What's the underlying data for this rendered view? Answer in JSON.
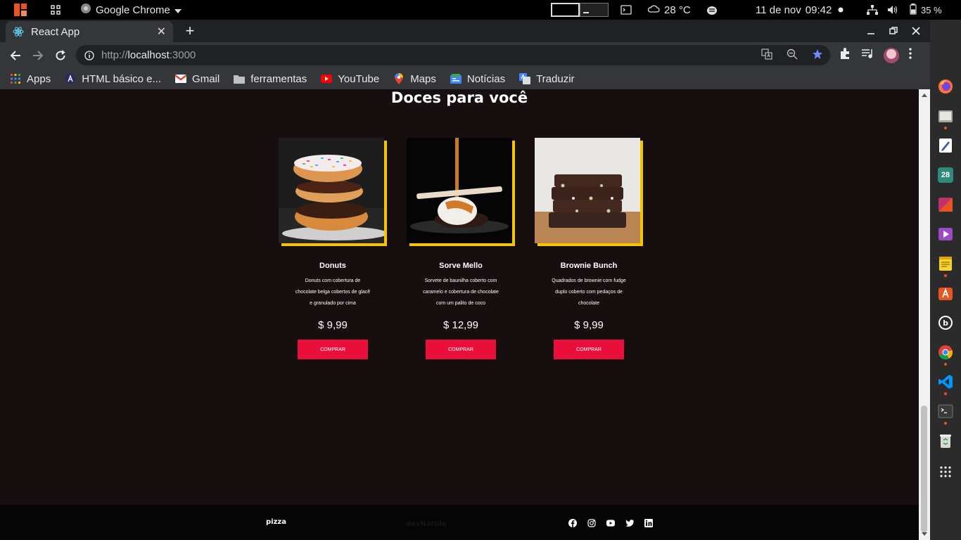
{
  "system": {
    "app_name": "Google Chrome",
    "temperature": "28 °C",
    "date": "11 de nov",
    "time": "09:42",
    "battery": "35 %"
  },
  "browser": {
    "tab_title": "React App",
    "url_scheme": "http://",
    "url_host": "localhost",
    "url_port": ":3000",
    "bookmarks": [
      {
        "label": "Apps",
        "icon": "apps-grid-icon"
      },
      {
        "label": "HTML básico e...",
        "icon": "aleth-icon"
      },
      {
        "label": "Gmail",
        "icon": "gmail-icon"
      },
      {
        "label": "ferramentas",
        "icon": "folder-icon"
      },
      {
        "label": "YouTube",
        "icon": "youtube-icon"
      },
      {
        "label": "Maps",
        "icon": "maps-pin-icon"
      },
      {
        "label": "Notícias",
        "icon": "news-icon"
      },
      {
        "label": "Traduzir",
        "icon": "translate-icon"
      }
    ]
  },
  "page": {
    "section_title": "Doces para você",
    "accent_color": "#f7c500",
    "button_color": "#ea0f3b",
    "products": [
      {
        "name": "Donuts",
        "description": "Donuts com cobertura de chocolate belga cobertos de glacê e granulado por cima",
        "price": "$ 9,99",
        "button": "COMPRAR"
      },
      {
        "name": "Sorve Mello",
        "description": "Sorvete de baunilha coberto com caramelo e cobertura de chocolate com um palito de coco",
        "price": "$ 12,99",
        "button": "COMPRAR"
      },
      {
        "name": "Brownie Bunch",
        "description": "Quadrados de brownie com fudge duplo coberto com pedaços de chocolate",
        "price": "$ 9,99",
        "button": "COMPRAR"
      }
    ],
    "footer": {
      "brand": "pizza",
      "dev": "devNarlila",
      "social": [
        "facebook-icon",
        "instagram-icon",
        "youtube-icon",
        "twitter-icon",
        "linkedin-icon"
      ]
    }
  },
  "dock": {
    "calendar_day": "28"
  }
}
